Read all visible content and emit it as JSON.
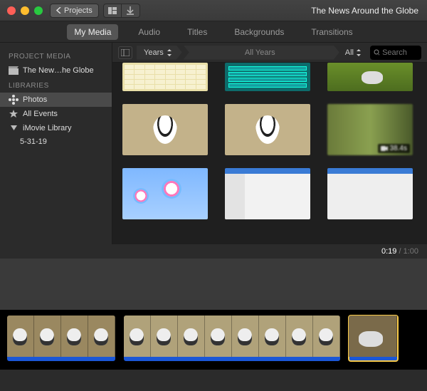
{
  "titlebar": {
    "back_label": "Projects",
    "title": "The News Around the Globe"
  },
  "tabs": {
    "items": [
      "My Media",
      "Audio",
      "Titles",
      "Backgrounds",
      "Transitions"
    ],
    "active_index": 0
  },
  "sidebar": {
    "section1_header": "PROJECT MEDIA",
    "project_item": "The New…he Globe",
    "section2_header": "LIBRARIES",
    "photos_label": "Photos",
    "all_events_label": "All Events",
    "imovie_library_label": "iMovie Library",
    "event_items": [
      "5-31-19"
    ]
  },
  "browser_bar": {
    "grouping_label": "Years",
    "range_label": "All Years",
    "filter_label": "All",
    "search_placeholder": "Search"
  },
  "media_grid": {
    "rows": [
      [
        {
          "name": "word-game-thumb",
          "kind": "th-word",
          "cut": true
        },
        {
          "name": "quiz-panel-thumb",
          "kind": "th-teal",
          "cut": true
        },
        {
          "name": "dog-grass-thumb",
          "kind": "th-grass",
          "cut": true
        }
      ],
      [
        {
          "name": "dog-floor-thumb-1",
          "kind": "th-dog"
        },
        {
          "name": "dog-floor-thumb-2",
          "kind": "th-dog"
        },
        {
          "name": "motion-blur-thumb",
          "kind": "th-blur",
          "video_badge": "38.4s"
        }
      ],
      [
        {
          "name": "balloons-sky-thumb",
          "kind": "th-sky"
        },
        {
          "name": "settings-window-thumb",
          "kind": "th-app"
        },
        {
          "name": "browser-window-thumb",
          "kind": "th-app2"
        }
      ]
    ]
  },
  "playhead_time": {
    "current": "0:19",
    "total": "1:00"
  },
  "timeline": {
    "clips": [
      {
        "name": "clip-1",
        "frames": 4,
        "class": "clip1"
      },
      {
        "name": "clip-2",
        "frames": 8,
        "class": "clip2"
      },
      {
        "name": "clip-3-selected",
        "frames": 1,
        "class": "clip3",
        "selected": true
      }
    ]
  }
}
